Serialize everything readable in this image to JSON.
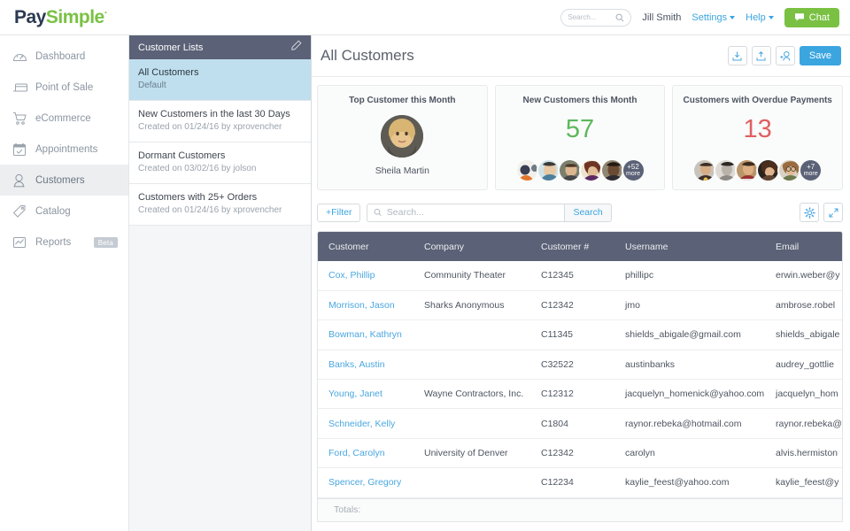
{
  "brand": {
    "part1": "Pay",
    "part2": "Simple",
    "trademark": "·"
  },
  "topbar": {
    "search_placeholder": "Search...",
    "search_value": "",
    "user": "Jill Smith",
    "settings": "Settings",
    "help": "Help",
    "chat": "Chat"
  },
  "sidebar": {
    "items": [
      {
        "label": "Dashboard",
        "icon": "gauge-icon",
        "active": false,
        "badge": ""
      },
      {
        "label": "Point of Sale",
        "icon": "card-reader-icon",
        "active": false,
        "badge": ""
      },
      {
        "label": "eCommerce",
        "icon": "shopping-cart-icon",
        "active": false,
        "badge": ""
      },
      {
        "label": "Appointments",
        "icon": "calendar-icon",
        "active": false,
        "badge": ""
      },
      {
        "label": "Customers",
        "icon": "person-icon",
        "active": true,
        "badge": ""
      },
      {
        "label": "Catalog",
        "icon": "tag-icon",
        "active": false,
        "badge": ""
      },
      {
        "label": "Reports",
        "icon": "chart-icon",
        "active": false,
        "badge": "Beta"
      }
    ]
  },
  "list_panel": {
    "header": "Customer Lists",
    "edit_icon": "pencil-icon",
    "items": [
      {
        "title": "All Customers",
        "subtitle": "Default",
        "selected": true
      },
      {
        "title": "New Customers in the last 30 Days",
        "subtitle": "Created on 01/24/16 by xprovencher",
        "selected": false
      },
      {
        "title": "Dormant Customers",
        "subtitle": "Created on 03/02/16 by jolson",
        "selected": false
      },
      {
        "title": "Customers with 25+ Orders",
        "subtitle": "Created on 01/24/16 by xprovencher",
        "selected": false
      }
    ]
  },
  "main": {
    "title": "All Customers",
    "actions": {
      "download": "download-icon",
      "upload": "upload-icon",
      "add_customer": "add-person-icon",
      "save": "Save"
    },
    "cards": [
      {
        "title": "Top Customer this Month",
        "type": "avatar",
        "customer_name": "Sheila Martin"
      },
      {
        "title": "New Customers this Month",
        "type": "count",
        "value": "57",
        "value_color": "#5cb85c",
        "avatars": 5,
        "more_count": "+52",
        "more_label": "more"
      },
      {
        "title": "Customers with Overdue Payments",
        "type": "count",
        "value": "13",
        "value_color": "#e06060",
        "avatars": 5,
        "more_count": "+7",
        "more_label": "more"
      }
    ],
    "toolbar": {
      "filter": "+Filter",
      "search_placeholder": "Search...",
      "search_value": "",
      "search_button": "Search",
      "settings_icon": "gear-icon",
      "expand_icon": "expand-arrows-icon"
    },
    "table": {
      "columns": [
        "Customer",
        "Company",
        "Customer #",
        "Username",
        "Email"
      ],
      "rows": [
        {
          "customer": "Cox, Phillip",
          "company": "Community Theater",
          "number": "C12345",
          "username": "phillipc",
          "email": "erwin.weber@y"
        },
        {
          "customer": "Morrison, Jason",
          "company": "Sharks Anonymous",
          "number": "C12342",
          "username": "jmo",
          "email": "ambrose.robel"
        },
        {
          "customer": "Bowman, Kathryn",
          "company": "",
          "number": "C11345",
          "username": "shields_abigale@gmail.com",
          "email": "shields_abigale"
        },
        {
          "customer": "Banks, Austin",
          "company": "",
          "number": "C32522",
          "username": "austinbanks",
          "email": "audrey_gottlie"
        },
        {
          "customer": "Young, Janet",
          "company": "Wayne Contractors, Inc.",
          "number": "C12312",
          "username": "jacquelyn_homenick@yahoo.com",
          "email": "jacquelyn_hom"
        },
        {
          "customer": "Schneider, Kelly",
          "company": "",
          "number": "C1804",
          "username": "raynor.rebeka@hotmail.com",
          "email": "raynor.rebeka@"
        },
        {
          "customer": "Ford, Carolyn",
          "company": "University of Denver",
          "number": "C12342",
          "username": "carolyn",
          "email": "alvis.hermiston"
        },
        {
          "customer": "Spencer, Gregory",
          "company": "",
          "number": "C12234",
          "username": "kaylie_feest@yahoo.com",
          "email": "kaylie_feest@y"
        }
      ],
      "totals_label": "Totals:"
    }
  }
}
